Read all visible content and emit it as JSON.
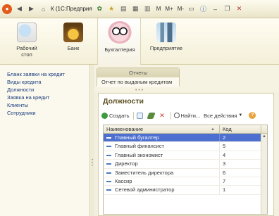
{
  "titlebar": {
    "title": "К  (1С:Предприя",
    "m_labels": [
      "M",
      "M+",
      "M-"
    ]
  },
  "sections": [
    {
      "label": "Рабочий стол"
    },
    {
      "label": "Банк"
    },
    {
      "label": "Бухгалтерия"
    },
    {
      "label": "Предприятие"
    }
  ],
  "nav": {
    "items": [
      "Бланк заявки на кредит",
      "Виды кредита",
      "Должности",
      "Заявка на кредит",
      "Клиенты",
      "Сотрудники"
    ]
  },
  "reports": {
    "title": "Отчеты",
    "items": [
      "Отчет по выданым кредитам"
    ]
  },
  "form": {
    "title": "Должности",
    "toolbar": {
      "create_label": "Создать",
      "find_label": "Найти...",
      "all_actions_label": "Все действия"
    },
    "columns": [
      "Наименование",
      "Код"
    ],
    "rows": [
      {
        "name": "Главный бугалтер",
        "code": "2"
      },
      {
        "name": "Главный финансист",
        "code": "5"
      },
      {
        "name": "Главный экономист",
        "code": "4"
      },
      {
        "name": "Директор",
        "code": "3"
      },
      {
        "name": "Заместитель директора",
        "code": "6"
      },
      {
        "name": "Кассир",
        "code": "7"
      },
      {
        "name": "Сетевой администратор",
        "code": "1"
      }
    ]
  }
}
